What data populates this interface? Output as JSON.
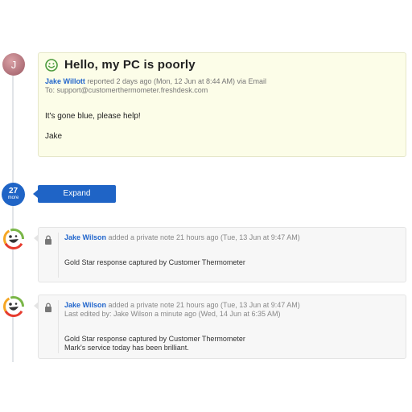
{
  "ticket": {
    "avatar_initial": "J",
    "title": "Hello, my PC is poorly",
    "author": "Jake Willott",
    "meta": " reported 2 days ago (Mon, 12 Jun at 8:44 AM) via Email",
    "to": "To: support@customerthermometer.freshdesk.com",
    "body_line1": "It's gone blue, please help!",
    "body_line2": "Jake"
  },
  "more": {
    "count": "27",
    "label": "more",
    "expand_label": "Expand"
  },
  "notes": [
    {
      "author": "Jake Wilson",
      "meta": " added a private note 21 hours ago (Tue, 13 Jun at 9:47 AM)",
      "edited": "",
      "body_line1": "Gold Star response captured by Customer Thermometer",
      "body_line2": ""
    },
    {
      "author": "Jake Wilson",
      "meta": " added a private note 21 hours ago (Tue, 13 Jun at 9:47 AM)",
      "edited": "Last edited by: Jake Wilson a minute ago (Wed, 14 Jun at 6:35 AM)",
      "body_line1": "Gold Star response captured by Customer Thermometer",
      "body_line2": "Mark's service today has been brilliant."
    }
  ],
  "colors": {
    "accent": "#1f64c6",
    "ticket_bg": "#fcfde8",
    "note_bg": "#f7f7f7",
    "smile": "#4a9a3c"
  },
  "icons": {
    "ticket_status": "smile-icon",
    "note_privacy": "lock-icon",
    "note_avatar": "thermometer-logo-icon"
  }
}
